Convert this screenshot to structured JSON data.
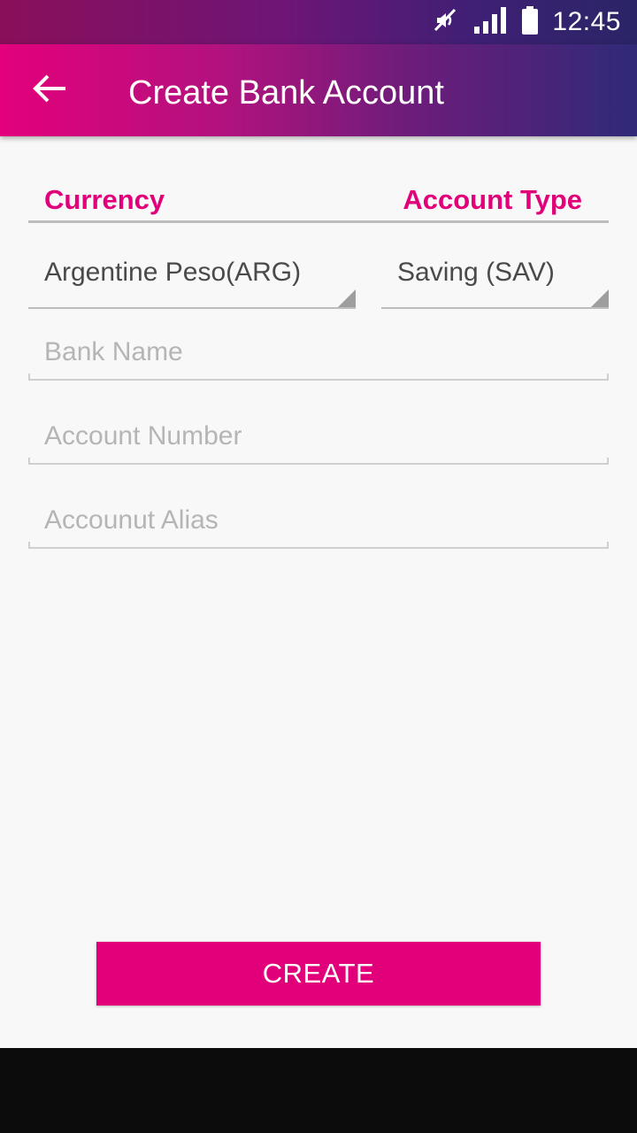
{
  "status_bar": {
    "time": "12:45",
    "icons": [
      "mute-icon",
      "signal-icon",
      "battery-icon"
    ]
  },
  "app_bar": {
    "back_icon": "arrow-left-icon",
    "title": "Create Bank Account"
  },
  "form": {
    "currency_label": "Currency",
    "account_type_label": "Account Type",
    "currency_value": "Argentine Peso(ARG)",
    "account_type_value": "Saving (SAV)",
    "bank_name_placeholder": "Bank Name",
    "bank_name_value": "",
    "account_number_placeholder": "Account Number",
    "account_number_value": "",
    "account_alias_placeholder": "Accounut Alias",
    "account_alias_value": ""
  },
  "actions": {
    "create_label": "CREATE"
  },
  "colors": {
    "accent": "#e2007a",
    "appbar_start": "#e3007c",
    "appbar_end": "#2f2a78"
  }
}
